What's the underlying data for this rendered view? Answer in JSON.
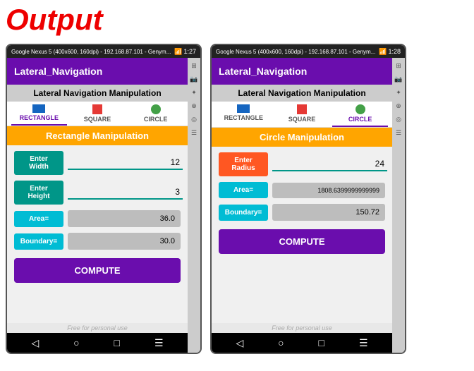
{
  "title": "Output",
  "phone1": {
    "status_bar": {
      "title": "Google Nexus 5 (400x600, 160dpi) - 192.168.87.101 - Genym...",
      "time": "1:27"
    },
    "app_title": "Lateral_Navigation",
    "section_title": "Lateral Navigation Manipulation",
    "tabs": [
      {
        "label": "RECTANGLE",
        "active": true,
        "icon_type": "rect",
        "icon_color": "#1565C0"
      },
      {
        "label": "SQUARE",
        "active": false,
        "icon_type": "square",
        "icon_color": "#e53935"
      },
      {
        "label": "CIRCLE",
        "active": false,
        "icon_type": "circle",
        "icon_color": "#43a047"
      }
    ],
    "manip_title": "Rectangle Manipulation",
    "fields": [
      {
        "label": "Enter Width",
        "value": "12",
        "type": "input"
      },
      {
        "label": "Enter Height",
        "value": "3",
        "type": "input"
      }
    ],
    "results": [
      {
        "label": "Area=",
        "value": "36.0"
      },
      {
        "label": "Boundary=",
        "value": "30.0"
      }
    ],
    "compute_btn": "COMPUTE",
    "watermark": "Free for personal use"
  },
  "phone2": {
    "status_bar": {
      "title": "Google Nexus 5 (400x600, 160dpi) - 192.168.87.101 - Genym...",
      "time": "1:28"
    },
    "app_title": "Lateral_Navigation",
    "section_title": "Lateral Navigation Manipulation",
    "tabs": [
      {
        "label": "RECTANGLE",
        "active": false,
        "icon_type": "rect",
        "icon_color": "#1565C0"
      },
      {
        "label": "SQUARE",
        "active": false,
        "icon_type": "square",
        "icon_color": "#e53935"
      },
      {
        "label": "CIRCLE",
        "active": true,
        "icon_type": "circle",
        "icon_color": "#43a047"
      }
    ],
    "manip_title": "Circle Manipulation",
    "fields": [
      {
        "label": "Enter Radius",
        "value": "24",
        "type": "input"
      }
    ],
    "results": [
      {
        "label": "Area=",
        "value": "1808.6399999999999"
      },
      {
        "label": "Boundary=",
        "value": "150.72"
      }
    ],
    "compute_btn": "COMPUTE",
    "watermark": "Free for personal use"
  },
  "sidebar_icons": [
    "⊞",
    "📷",
    "✦",
    "⊕",
    "◎",
    "☰"
  ]
}
